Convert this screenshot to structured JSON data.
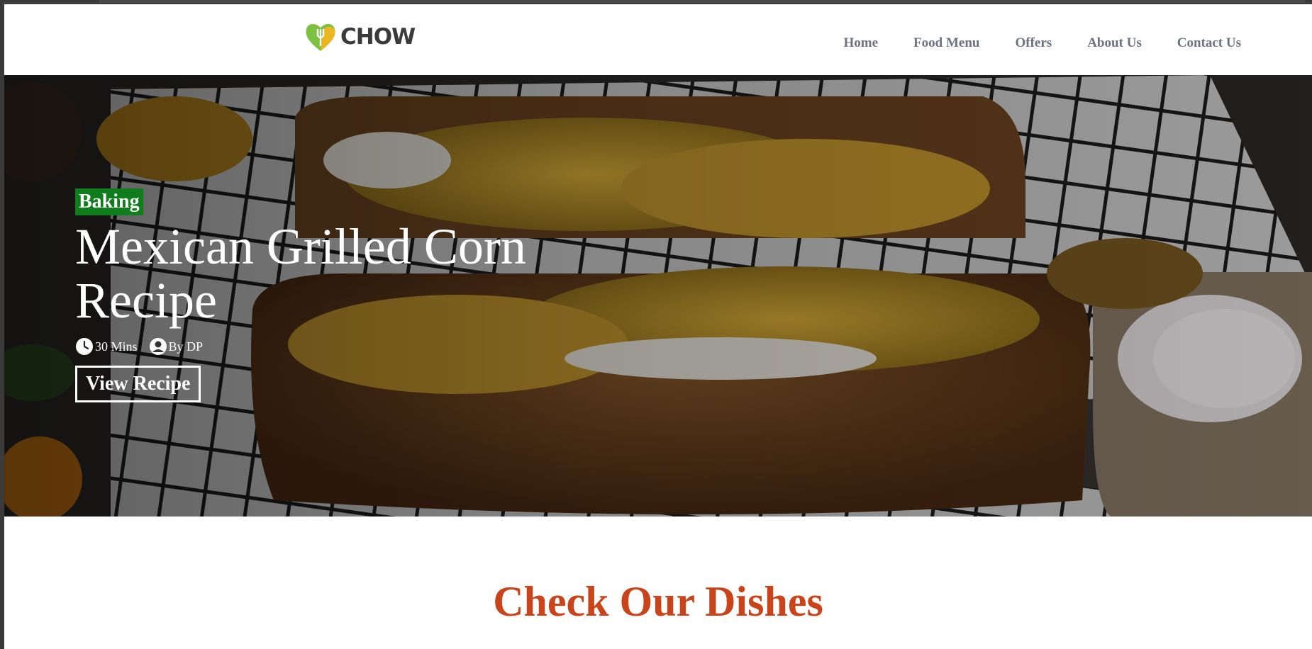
{
  "brand": {
    "name": "CHOW",
    "logo_icon": "heart-fork-icon",
    "colors": {
      "green": "#7cc142",
      "yellow": "#f6b51e",
      "text": "#3b3b3b"
    }
  },
  "nav": {
    "items": [
      {
        "label": "Home"
      },
      {
        "label": "Food Menu"
      },
      {
        "label": "Offers"
      },
      {
        "label": "About Us"
      },
      {
        "label": "Contact Us"
      }
    ]
  },
  "hero": {
    "badge": "Baking",
    "badge_color": "#0f7d1b",
    "title": "Mexican Grilled Corn Recipe",
    "time": {
      "icon": "clock-icon",
      "text": "30 Mins"
    },
    "author": {
      "icon": "user-circle-icon",
      "text": "By DP"
    },
    "button": "View Recipe"
  },
  "section": {
    "title": "Check Our Dishes",
    "title_color": "#c9441a"
  }
}
